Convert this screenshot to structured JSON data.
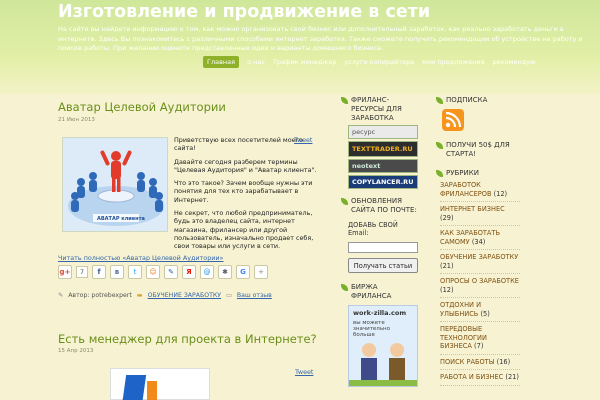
{
  "site": {
    "title": "Изготовление и продвижение в сети",
    "description": "На сайте вы найдете информацию о том, как можно организовать свой бизнес или дополнительный заработок, как реально заработать деньги в интернете. Здесь Вы познакомитесь с различными способами интернет заработка. Также сможете получить рекомендации об устройстве на работу и поиске работы. При желании оцените представленные идеи и варианты домашнего бизнеса."
  },
  "nav": {
    "items": [
      {
        "label": "Главная",
        "active": true
      },
      {
        "label": "о нас"
      },
      {
        "label": "Трафик менеджер"
      },
      {
        "label": "услуги копирайтера"
      },
      {
        "label": "мои предложения"
      },
      {
        "label": "рекомендую"
      }
    ]
  },
  "post1": {
    "title": "Аватар Целевой Аудитории",
    "date": "21 Июн 2013",
    "image_caption": "АВАТАР клиента",
    "paragraphs": [
      "Приветствую всех посетителей моего сайта!",
      "Давайте сегодня разберем термины \"Целевая Аудитория\" и \"Аватар клиента\".",
      "Что это такое? Зачем вообще нужны эти понятия для тех кто зарабатывает в Интернет.",
      "Не секрет, что любой предприниматель, будь это владелец сайта, интернет магазина, фрилансер или другой пользователь, изначально продает себя, свои товары или услуги в сети."
    ],
    "tweet": "Tweet",
    "read_more": "Читать полностью «Аватар Целевой Аудитории»",
    "share_count": "7",
    "author_label": "Автор: potrebexpert",
    "category": "ОБУЧЕНИЕ ЗАРАБОТКУ",
    "comments": "Ваш отзыв"
  },
  "post2": {
    "title": "Есть менеджер для проекта в Интернете?",
    "date": "15 Апр 2013",
    "tweet": "Tweet"
  },
  "sidebar_mid": {
    "freelance_title": "ФРИЛАНС-РЕСУРСЫ ДЛЯ ЗАРАБОТКА",
    "banners": [
      "ресурс",
      "TEXTTRADER.RU",
      "neotext",
      "COPYLANCER.RU"
    ],
    "subscribe_title": "ОБНОВЛЕНИЯ САЙТА ПО ПОЧТЕ:",
    "subscribe_label": "ДОБАВЬ СВОЙ Email:",
    "subscribe_btn": "Получать статьи",
    "birzha_title": "БИРЖА ФРИЛАНСА",
    "birzha_banner": "work-zilla.com",
    "birzha_text": "вы можете значительно больше"
  },
  "sidebar_right": {
    "subscribe_title": "ПОДПИСКА",
    "bonus_title": "ПОЛУЧИ 50$ ДЛЯ СТАРТА!",
    "rubrics_title": "РУБРИКИ",
    "categories": [
      {
        "name": "ЗАРАБОТОК ФРИЛАНСЕРОВ",
        "count": "(12)"
      },
      {
        "name": "ИНТЕРНЕТ БИЗНЕС",
        "count": "(29)"
      },
      {
        "name": "КАК ЗАРАБОТАТЬ САМОМУ",
        "count": "(34)"
      },
      {
        "name": "ОБУЧЕНИЕ ЗАРАБОТКУ",
        "count": "(21)"
      },
      {
        "name": "ОПРОСЫ О ЗАРАБОТКЕ",
        "count": "(12)"
      },
      {
        "name": "ОТДОХНИ И УЛЫБНИСЬ",
        "count": "(5)"
      },
      {
        "name": "ПЕРЕДОВЫЕ ТЕХНОЛОГИИ БИЗНЕСА",
        "count": "(7)"
      },
      {
        "name": "ПОИСК РАБОТЫ",
        "count": "(16)"
      },
      {
        "name": "РАБОТА И БИЗНЕС",
        "count": "(21)"
      }
    ]
  },
  "colors": {
    "accent_green": "#6a8e1a",
    "link_blue": "#3366aa",
    "category_brown": "#7e5010"
  }
}
